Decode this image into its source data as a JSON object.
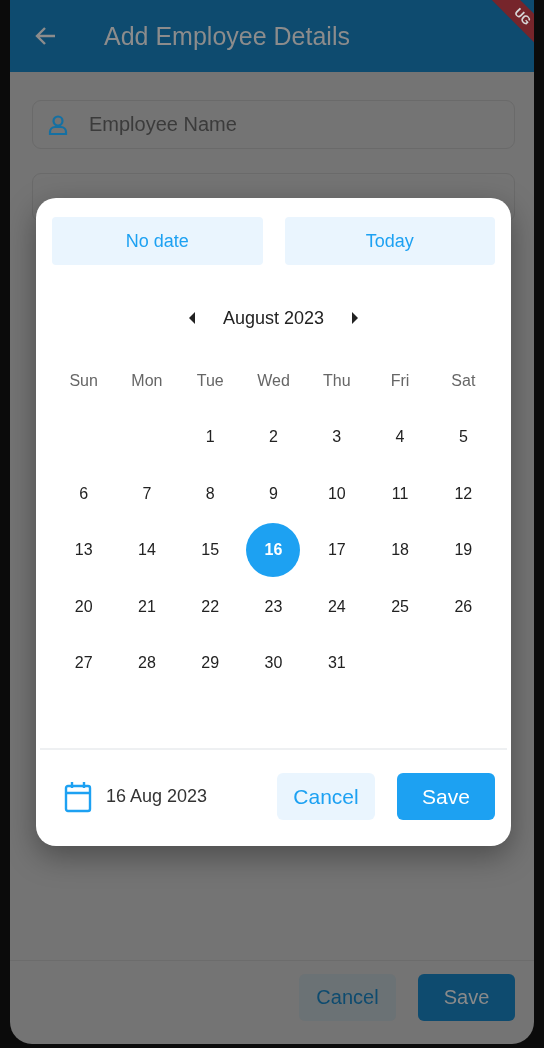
{
  "app_bar": {
    "title": "Add Employee Details"
  },
  "debug_banner": {
    "text": "UG"
  },
  "fields": [
    {
      "kind": "person",
      "placeholder": "Employee Name"
    },
    {
      "kind": "dropdown"
    }
  ],
  "date_picker": {
    "quick_buttons": [
      "No date",
      "Today"
    ],
    "month": "August 2023",
    "weekdays": [
      "Sun",
      "Mon",
      "Tue",
      "Wed",
      "Thu",
      "Fri",
      "Sat"
    ],
    "weeks": [
      [
        {
          "kind": "blank"
        },
        {
          "kind": "blank"
        },
        {
          "kind": "day",
          "label": "1",
          "selected": false
        },
        {
          "kind": "day",
          "label": "2",
          "selected": false
        },
        {
          "kind": "day",
          "label": "3",
          "selected": false
        },
        {
          "kind": "day",
          "label": "4",
          "selected": false
        },
        {
          "kind": "day",
          "label": "5",
          "selected": false
        }
      ],
      [
        {
          "kind": "day",
          "label": "6",
          "selected": false
        },
        {
          "kind": "day",
          "label": "7",
          "selected": false
        },
        {
          "kind": "day",
          "label": "8",
          "selected": false
        },
        {
          "kind": "day",
          "label": "9",
          "selected": false
        },
        {
          "kind": "day",
          "label": "10",
          "selected": false
        },
        {
          "kind": "day",
          "label": "11",
          "selected": false
        },
        {
          "kind": "day",
          "label": "12",
          "selected": false
        }
      ],
      [
        {
          "kind": "day",
          "label": "13",
          "selected": false
        },
        {
          "kind": "day",
          "label": "14",
          "selected": false
        },
        {
          "kind": "day",
          "label": "15",
          "selected": false
        },
        {
          "kind": "day",
          "label": "16",
          "selected": true
        },
        {
          "kind": "day",
          "label": "17",
          "selected": false
        },
        {
          "kind": "day",
          "label": "18",
          "selected": false
        },
        {
          "kind": "day",
          "label": "19",
          "selected": false
        }
      ],
      [
        {
          "kind": "day",
          "label": "20",
          "selected": false
        },
        {
          "kind": "day",
          "label": "21",
          "selected": false
        },
        {
          "kind": "day",
          "label": "22",
          "selected": false
        },
        {
          "kind": "day",
          "label": "23",
          "selected": false
        },
        {
          "kind": "day",
          "label": "24",
          "selected": false
        },
        {
          "kind": "day",
          "label": "25",
          "selected": false
        },
        {
          "kind": "day",
          "label": "26",
          "selected": false
        }
      ],
      [
        {
          "kind": "day",
          "label": "27",
          "selected": false
        },
        {
          "kind": "day",
          "label": "28",
          "selected": false
        },
        {
          "kind": "day",
          "label": "29",
          "selected": false
        },
        {
          "kind": "day",
          "label": "30",
          "selected": false
        },
        {
          "kind": "day",
          "label": "31",
          "selected": false
        }
      ]
    ],
    "selected_date": "16 Aug 2023",
    "cancel": "Cancel",
    "save": "Save"
  },
  "footer": {
    "cancel": "Cancel",
    "save": "Save"
  }
}
